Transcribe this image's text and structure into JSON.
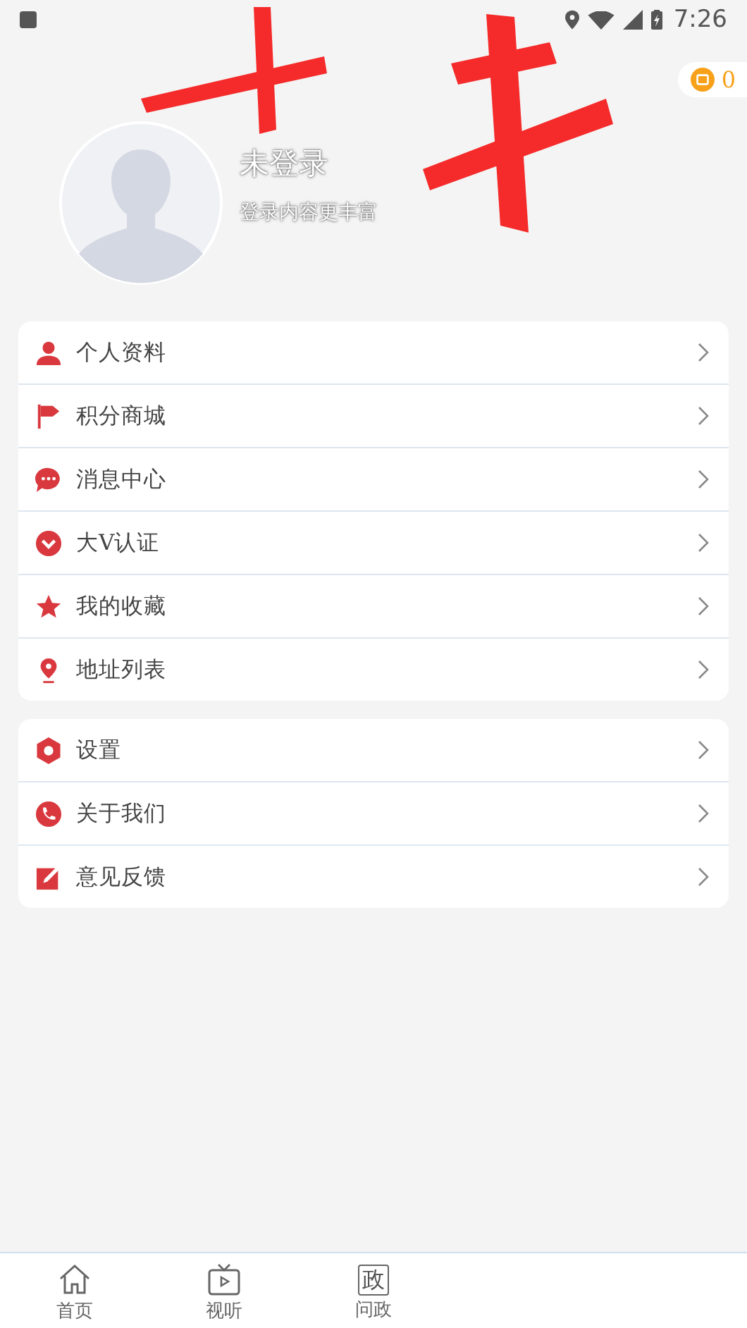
{
  "status_bar": {
    "time": "7:26"
  },
  "header": {
    "coins": "0",
    "user_name": "未登录",
    "subtitle": "登录内容更丰富"
  },
  "menu_groups": [
    {
      "items": [
        {
          "kind": "person",
          "label": "个人资料"
        },
        {
          "kind": "flag",
          "label": "积分商城"
        },
        {
          "kind": "chat",
          "label": "消息中心"
        },
        {
          "kind": "badge",
          "label": "大V认证"
        },
        {
          "kind": "star",
          "label": "我的收藏"
        },
        {
          "kind": "pin",
          "label": "地址列表"
        }
      ]
    },
    {
      "items": [
        {
          "kind": "gear",
          "label": "设置"
        },
        {
          "kind": "phone",
          "label": "关于我们"
        },
        {
          "kind": "edit",
          "label": "意见反馈"
        }
      ]
    }
  ],
  "bottom_nav": [
    {
      "kind": "home",
      "label": "首页"
    },
    {
      "kind": "tv",
      "label": "视听"
    },
    {
      "kind": "glyph",
      "glyph": "政",
      "label": "问政"
    }
  ]
}
